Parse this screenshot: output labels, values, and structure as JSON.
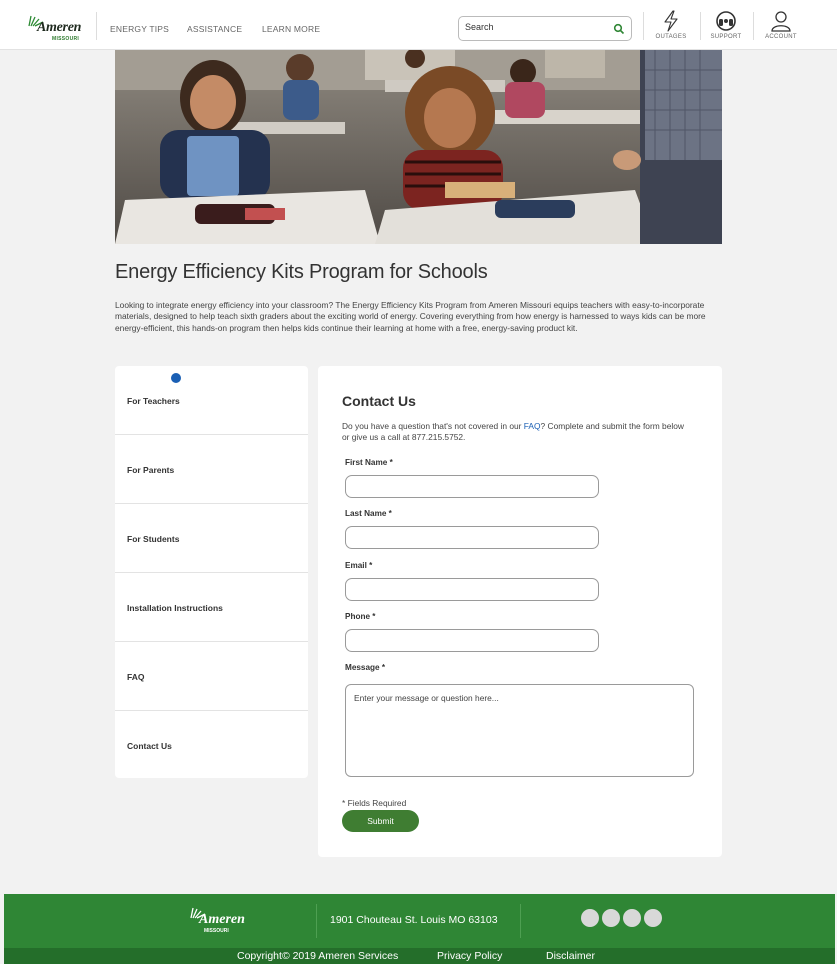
{
  "header": {
    "logo_text": "Ameren",
    "logo_sub": "MISSOURI",
    "nav": [
      "ENERGY TIPS",
      "ASSISTANCE",
      "LEARN MORE"
    ],
    "search_placeholder": "Search",
    "utility": [
      "OUTAGES",
      "SUPPORT",
      "ACCOUNT"
    ]
  },
  "hero": {
    "icon": "classroom-photo"
  },
  "page": {
    "title": "Energy Efficiency Kits Program for Schools",
    "intro": "Looking to integrate energy efficiency into your classroom? The Energy Efficiency Kits Program from Ameren Missouri equips teachers with easy-to-incorporate materials, designed to help teach sixth graders about the exciting world of energy. Covering everything from how energy is harnessed to ways kids can be more energy-efficient, this hands-on program then helps kids continue their learning at home with a free, energy-saving product kit."
  },
  "sidebar": {
    "items": [
      {
        "label": "For Teachers"
      },
      {
        "label": "For Parents"
      },
      {
        "label": "For Students"
      },
      {
        "label": "Installation Instructions"
      },
      {
        "label": "FAQ"
      },
      {
        "label": "Contact Us"
      }
    ],
    "active": "Contact Us"
  },
  "contact": {
    "title": "Contact Us",
    "desc_before": "Do you have a question that's not covered in our ",
    "desc_link": "FAQ",
    "desc_after": "? Complete and submit the form below or give us a call at 877.215.5752.",
    "fields": {
      "first_name": "First Name *",
      "last_name": "Last Name *",
      "email": "Email *",
      "phone": "Phone *",
      "message": "Message *"
    },
    "message_placeholder": "Enter your message or question here...",
    "required_note": "* Fields Required",
    "submit": "Submit"
  },
  "footer": {
    "logo_text": "Ameren",
    "logo_sub": "MISSOURI",
    "address": "1901 Chouteau  St. Louis  MO 63103",
    "social_count": 4,
    "links": [
      "Copyright© 2019 Ameren Services",
      "Privacy Policy",
      "Disclaimer"
    ]
  },
  "colors": {
    "brand_green": "#2f8635",
    "footer_bottom": "#246e2a",
    "submit_green": "#3f7d32",
    "link_blue": "#1a5fb4",
    "page_bg": "#f2f2f2"
  }
}
